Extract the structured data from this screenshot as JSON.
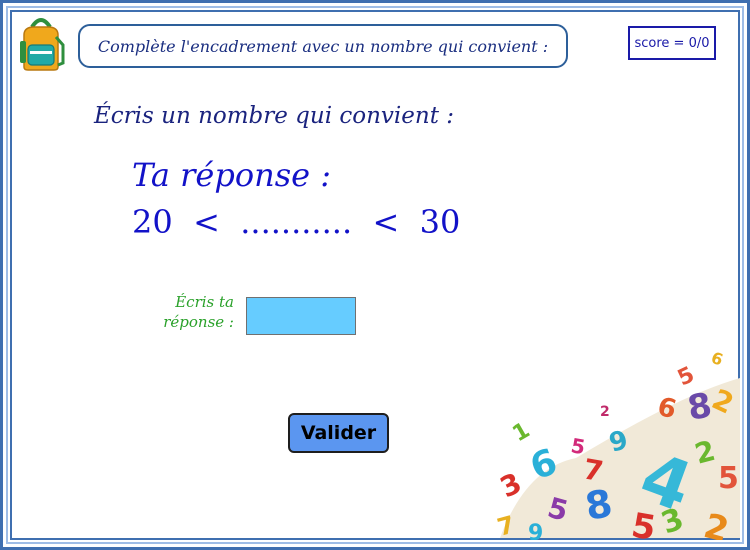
{
  "header": {
    "instruction": "Complète l'encadrement avec un nombre qui convient :",
    "score": "score = 0/0"
  },
  "main": {
    "subtitle": "Écris un nombre qui convient :",
    "answer_title": "Ta réponse :",
    "inequality": "20  <  ...........  <  30"
  },
  "form": {
    "label_line1": "Écris ta",
    "label_line2": "réponse :",
    "input_value": ""
  },
  "actions": {
    "valider_label": "Valider"
  },
  "decor": {
    "backpack": "backpack-icon",
    "numbers": "colorful-numbers-pile",
    "visible_digits": [
      "6",
      "5",
      "2",
      "3",
      "1",
      "4",
      "6",
      "8",
      "2",
      "5",
      "9",
      "7",
      "3",
      "2"
    ]
  },
  "colors": {
    "frame": "#3f6fb0",
    "text_blue": "#1212c8",
    "label_green": "#2aa12a",
    "input_bg": "#66ccff",
    "button_bg": "#5b96f0"
  }
}
